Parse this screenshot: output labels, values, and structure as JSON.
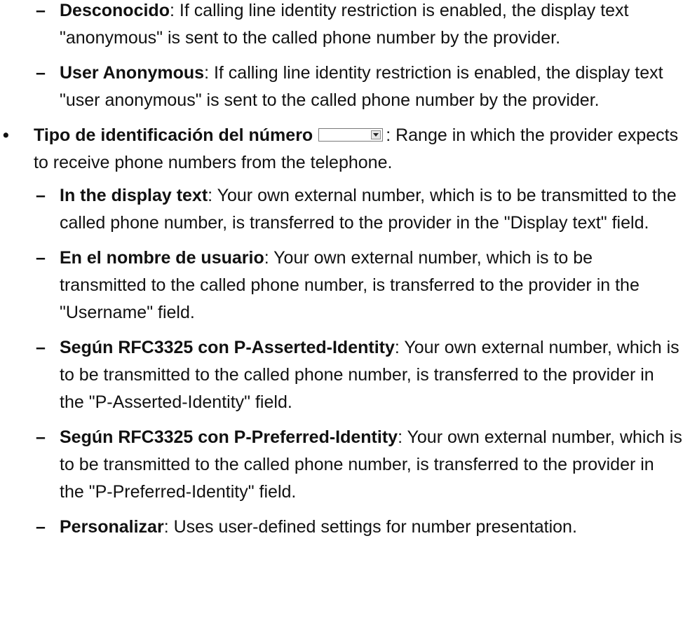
{
  "marker_dash": "–",
  "marker_bullet": "•",
  "items_top": [
    {
      "term": "Desconocido",
      "text": ": If calling line identity restriction is enabled, the display text \"anonymous\" is sent to the called phone number by the provider."
    },
    {
      "term": "User Anonymous",
      "text": ": If calling line identity restriction is enabled, the display text \"user anonymous\" is sent to the called phone number by the provider."
    }
  ],
  "bullet": {
    "term": "Tipo de identificación del número",
    "text": ": Range in which the provider expects to receive phone numbers from the telephone."
  },
  "items_sub": [
    {
      "term": "In the display text",
      "text": ": Your own external number, which is to be trans­mitted to the called phone number, is transferred to the provider in the \"Display text\" field."
    },
    {
      "term": "En el nombre de usuario",
      "text": ": Your own external number, which is to be transmitted to the called phone number, is transferred to the provider in the \"Username\" field."
    },
    {
      "term": "Según RFC3325 con P-Asserted-Identity",
      "text": ": Your own external number, which is to be transmitted to the called phone number, is transferred to the provider in the \"P-Asserted-Identity\" field."
    },
    {
      "term": "Según RFC3325 con P-Preferred-Identity",
      "text": ": Your own external number, which is to be transmitted to the called phone number, is transferred to the provider in the \"P-Preferred-Identity\" field."
    },
    {
      "term": "Personalizar",
      "text": ": Uses user-defined settings for number presentation."
    }
  ]
}
